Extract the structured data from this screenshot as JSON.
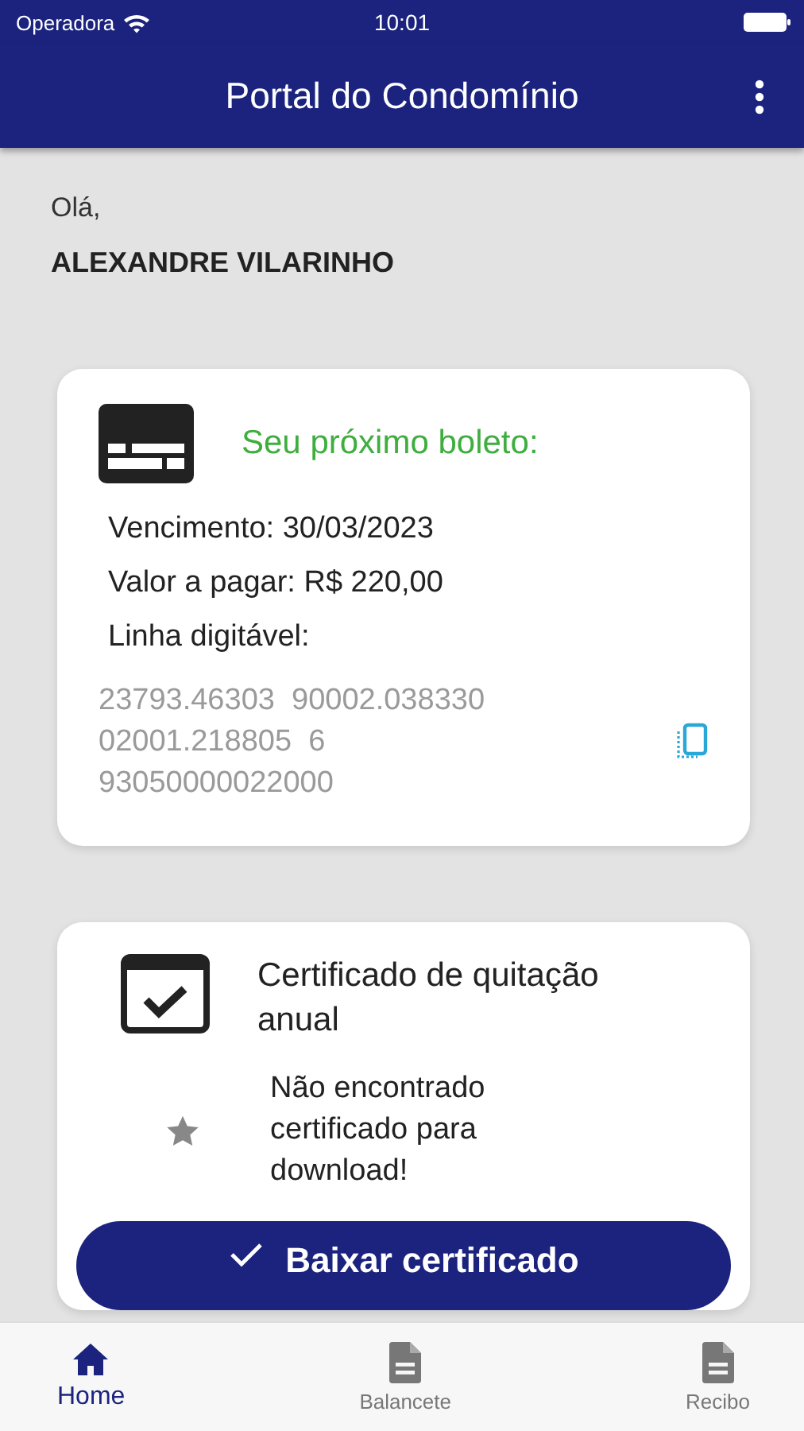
{
  "status_bar": {
    "carrier": "Operadora",
    "time": "10:01"
  },
  "app_bar": {
    "title": "Portal do Condomínio"
  },
  "greeting": {
    "hello": "Olá,",
    "name": "ALEXANDRE VILARINHO"
  },
  "boleto_card": {
    "title": "Seu próximo boleto:",
    "due": "Vencimento: 30/03/2023",
    "amount": "Valor a pagar: R$ 220,00",
    "line_label": "Linha digitável:",
    "line_lines": [
      "23793.46303  90002.038330",
      "02001.218805  6",
      "93050000022000"
    ]
  },
  "certificate_card": {
    "title": "Certificado de quitação anual",
    "message": "Não encontrado certificado para download!",
    "button": "Baixar certificado"
  },
  "tabs": [
    {
      "label": "Home",
      "kind": "home",
      "selected": true
    },
    {
      "label": "Balancete",
      "kind": "document",
      "selected": false
    },
    {
      "label": "Recibo",
      "kind": "document",
      "selected": false
    }
  ]
}
